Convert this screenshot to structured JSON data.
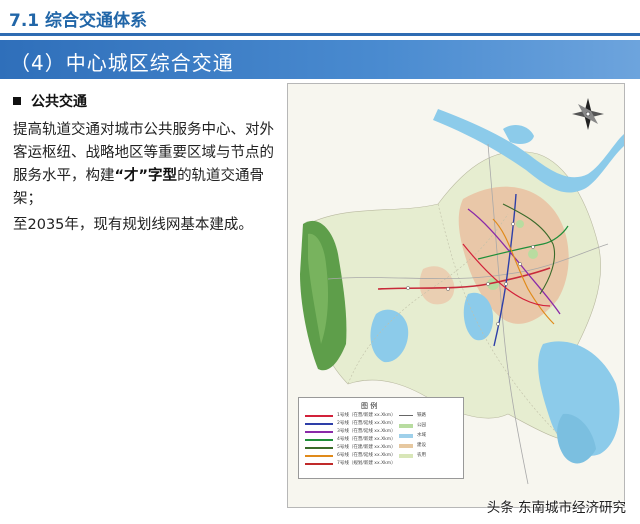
{
  "header": {
    "title": "7.1 综合交通体系"
  },
  "banner": {
    "title": "（4）中心城区综合交通"
  },
  "section": {
    "title": "公共交通"
  },
  "paragraphs": {
    "p1_prefix": "提高轨道交通对城市公共服务中心、对外客运枢纽、战略地区等重要区域与节点的服务水平，构建",
    "p1_quote": "“才”字型",
    "p1_suffix": "的轨道交通骨架；",
    "p2": "至2035年，现有规划线网基本建成。"
  },
  "map": {
    "legend_title": "图 例",
    "legend_lines": [
      {
        "label": "1号线（在营/新建 xx.Xkm）",
        "color": "#d2213a"
      },
      {
        "label": "2号线（在营/延线 xx.Xkm）",
        "color": "#2e3fa8"
      },
      {
        "label": "3号线（在营/延线 xx.Xkm）",
        "color": "#8a2aa8"
      },
      {
        "label": "4号线（在营/新建 xx.Xkm）",
        "color": "#1f8f3a"
      },
      {
        "label": "5号线（在建/新建 xx.Xkm）",
        "color": "#3a6a2a"
      },
      {
        "label": "6号线（在营/延线 xx.Xkm）",
        "color": "#e08a1a"
      },
      {
        "label": "7号线（规划/新建 xx.Xkm）",
        "color": "#c02a2a"
      }
    ],
    "legend_right": [
      {
        "label": "铁路",
        "color": "#666666"
      },
      {
        "label": "公园",
        "color": "#b8dca0"
      },
      {
        "label": "水域",
        "color": "#9fd0ea"
      },
      {
        "label": "建设",
        "color": "#e6c8a0"
      },
      {
        "label": "农用",
        "color": "#d8e6b8"
      }
    ],
    "colors": {
      "land": "#e9efd5",
      "urban": "#e9c7a8",
      "water": "#8ccbea",
      "forest": "#5e9e4a",
      "rail": "#c82a3a"
    }
  },
  "watermark": "头条 东南城市经济研究"
}
